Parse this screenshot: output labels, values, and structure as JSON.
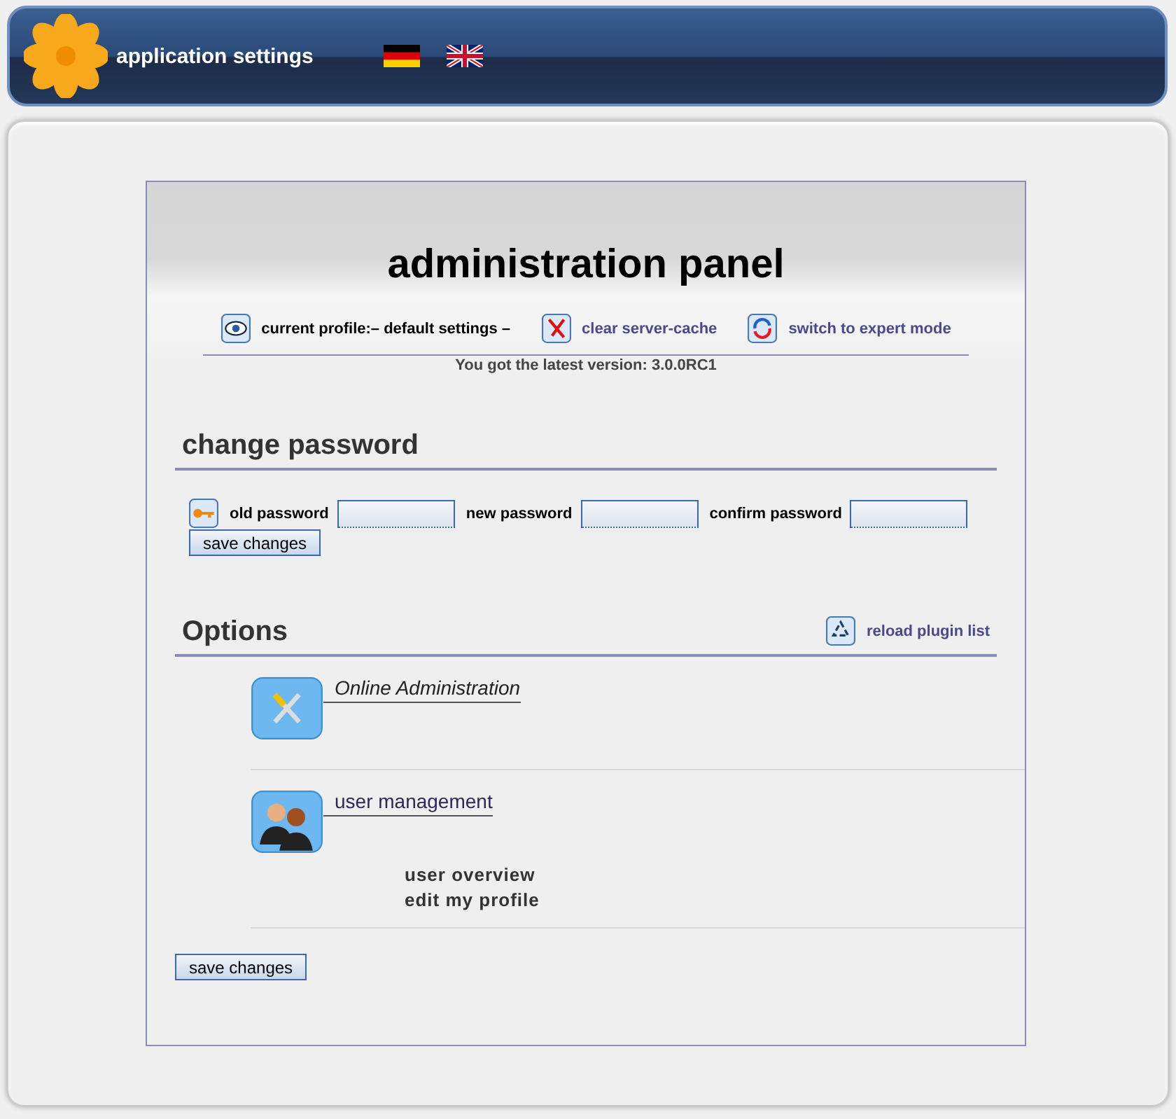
{
  "header": {
    "title": "application settings",
    "languages": [
      {
        "kind": "de"
      },
      {
        "kind": "en"
      }
    ]
  },
  "panel": {
    "title": "administration panel",
    "toolbar": [
      {
        "kind": "eye",
        "label": "current profile:– default settings –",
        "link": false
      },
      {
        "kind": "cross",
        "label": "clear server-cache",
        "link": true
      },
      {
        "kind": "refresh",
        "label": "switch to expert mode",
        "link": true
      }
    ],
    "version": "You got the latest version: 3.0.0RC1"
  },
  "password": {
    "heading": "change password",
    "fields": [
      {
        "label": "old password"
      },
      {
        "label": "new password"
      },
      {
        "label": "confirm password"
      }
    ],
    "button": "save changes"
  },
  "options": {
    "heading": "Options",
    "reload": "reload plugin list",
    "plugins": [
      {
        "kind": "tools",
        "title": "Online Administration",
        "italic": true
      },
      {
        "kind": "users",
        "title": "user management",
        "italic": false,
        "links": [
          "user overview",
          "edit my profile"
        ]
      }
    ]
  },
  "button": "save changes"
}
